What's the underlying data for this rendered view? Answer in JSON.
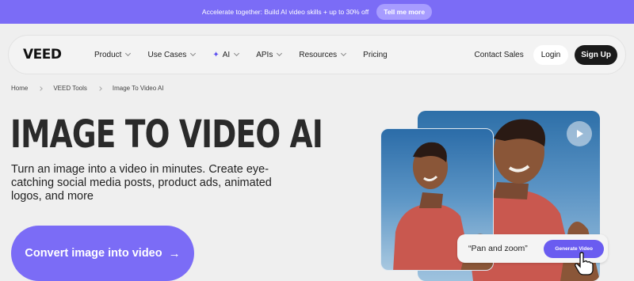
{
  "promo": {
    "text": "Accelerate together: Build AI video skills + up to 30% off",
    "button": "Tell me more"
  },
  "nav": {
    "logo": "VEED",
    "items": [
      {
        "label": "Product",
        "dropdown": true
      },
      {
        "label": "Use Cases",
        "dropdown": true
      },
      {
        "label": "AI",
        "dropdown": true,
        "icon": "sparkle-icon"
      },
      {
        "label": "APIs",
        "dropdown": true
      },
      {
        "label": "Resources",
        "dropdown": true
      },
      {
        "label": "Pricing",
        "dropdown": false
      }
    ],
    "contact": "Contact Sales",
    "login": "Login",
    "signup": "Sign Up"
  },
  "breadcrumb": [
    "Home",
    "VEED Tools",
    "Image To Video AI"
  ],
  "hero": {
    "title": "IMAGE TO VIDEO AI",
    "subtitle": "Turn an image into a video in minutes. Create eye-catching social media posts, product ads, animated logos, and more",
    "cta": "Convert image into video",
    "cta_icon": "arrow-right-icon"
  },
  "preview": {
    "prompt": "“Pan and zoom”",
    "generate": "Generate Video",
    "play_icon": "play-icon",
    "cursor_icon": "hand-pointer-icon"
  },
  "colors": {
    "accent": "#7b6cf6",
    "background": "#efefef",
    "dark": "#1a1a1a"
  }
}
